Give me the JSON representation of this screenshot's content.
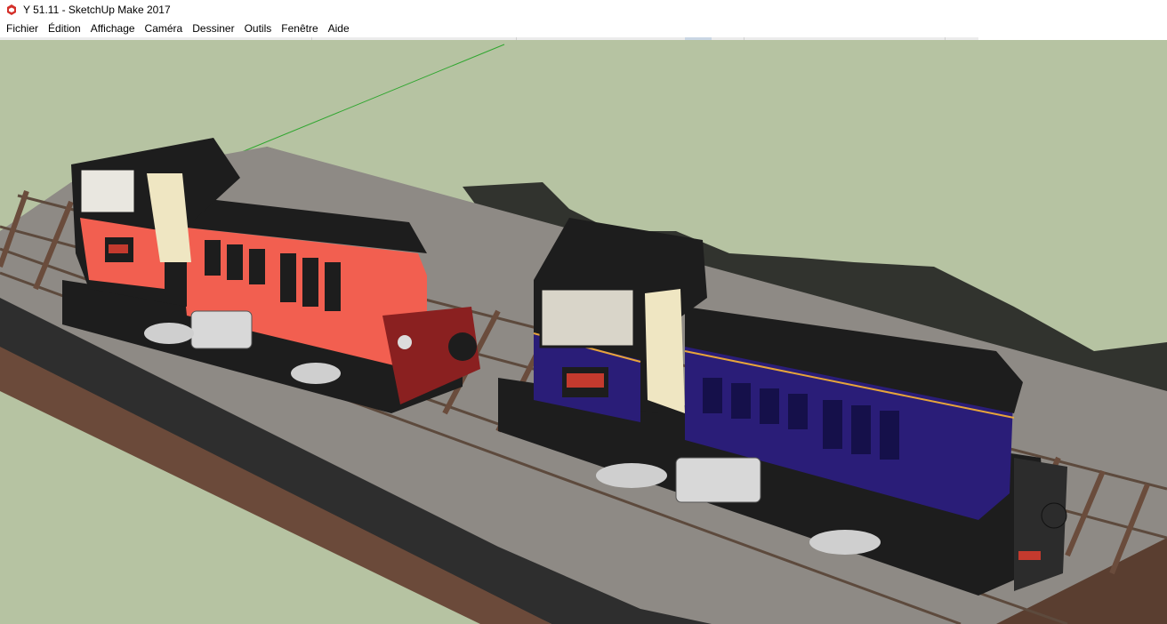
{
  "window": {
    "title": "Y 51.11 - SketchUp Make 2017",
    "icon": "sketchup-logo-icon"
  },
  "menu": {
    "items": [
      {
        "label": "Fichier"
      },
      {
        "label": "Édition"
      },
      {
        "label": "Affichage"
      },
      {
        "label": "Caméra"
      },
      {
        "label": "Dessiner"
      },
      {
        "label": "Outils"
      },
      {
        "label": "Fenêtre"
      },
      {
        "label": "Aide"
      }
    ]
  },
  "viewport": {
    "background": "#b6c3a2",
    "model": "two locomotives on tracks",
    "colors": {
      "salmon_loco": "#f25f50",
      "blue_loco": "#2a1d78",
      "cab_black": "#1d1d1d",
      "stripe": "#e7a43a",
      "green_axis": "#2fa62f",
      "ground": "#2e2e2e",
      "brick": "#6b4a3a",
      "ballast": "#8e8a85"
    }
  }
}
